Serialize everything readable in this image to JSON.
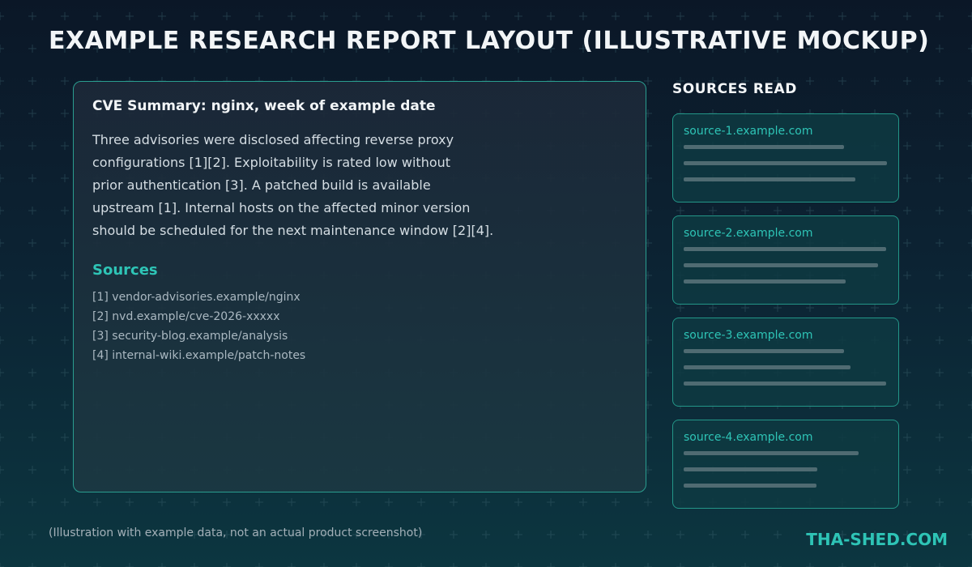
{
  "page": {
    "title": "EXAMPLE RESEARCH REPORT LAYOUT (ILLUSTRATIVE MOCKUP)"
  },
  "report": {
    "heading": "CVE Summary: nginx, week of example date",
    "body_lines": [
      "Three advisories were disclosed affecting reverse proxy",
      "configurations [1][2]. Exploitability is rated low without",
      "prior authentication [3]. A patched build is available",
      "upstream [1]. Internal hosts on the affected minor version",
      "should be scheduled for the next maintenance window [2][4]."
    ],
    "sources_heading": "Sources",
    "sources": [
      "[1] vendor-advisories.example/nginx",
      "[2] nvd.example/cve-2026-xxxxx",
      "[3] security-blog.example/analysis",
      "[4] internal-wiki.example/patch-notes"
    ]
  },
  "sidebar": {
    "title": "SOURCES READ",
    "cards": [
      {
        "title": "source-1.example.com"
      },
      {
        "title": "source-2.example.com"
      },
      {
        "title": "source-3.example.com"
      },
      {
        "title": "source-4.example.com"
      }
    ]
  },
  "footer": {
    "note": "(Illustration with example data, not an actual product screenshot)",
    "brand": "THA-SHED.COM"
  },
  "colors": {
    "accent": "#2ec4b6",
    "panel_border": "#2a9d8f",
    "background_top": "#0b1727",
    "background_bottom": "#0c3640"
  }
}
